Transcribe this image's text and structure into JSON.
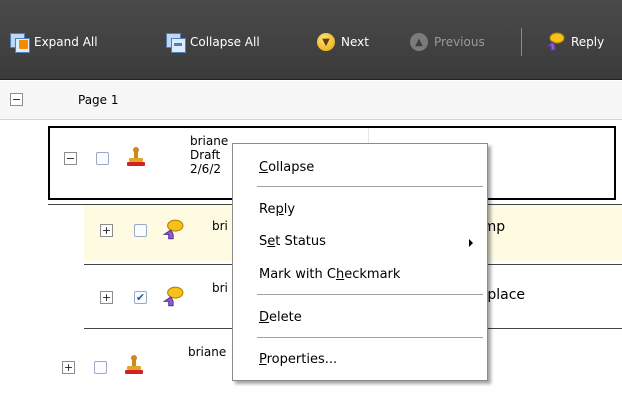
{
  "toolbar": {
    "expand_all": "Expand All",
    "collapse_all": "Collapse All",
    "next": "Next",
    "previous": "Previous",
    "reply": "Reply"
  },
  "page": {
    "label": "Page 1"
  },
  "comments": [
    {
      "author": "briane",
      "status": "Draft",
      "date": "2/6/2",
      "checked": false,
      "expanded": true
    },
    {
      "author": "bri",
      "text": "amp",
      "checked": false,
      "expanded": false
    },
    {
      "author": "bri",
      "text": "g place",
      "checked": true,
      "expanded": false
    },
    {
      "author": "briane",
      "checked": false,
      "expanded": false
    }
  ],
  "context_menu": {
    "collapse": {
      "pre": "",
      "u": "C",
      "post": "ollapse"
    },
    "reply": {
      "pre": "Re",
      "u": "p",
      "post": "ly"
    },
    "set_status": {
      "pre": "S",
      "u": "e",
      "post": "t Status"
    },
    "mark_checkmark": {
      "pre": "Mark with C",
      "u": "h",
      "post": "eckmark"
    },
    "delete": {
      "pre": "",
      "u": "D",
      "post": "elete"
    },
    "properties": {
      "pre": "",
      "u": "P",
      "post": "roperties..."
    }
  },
  "colors": {
    "toolbar_bg": "#444444",
    "reply_row_bg": "#fffbe3",
    "next_icon": "#f0b400"
  }
}
